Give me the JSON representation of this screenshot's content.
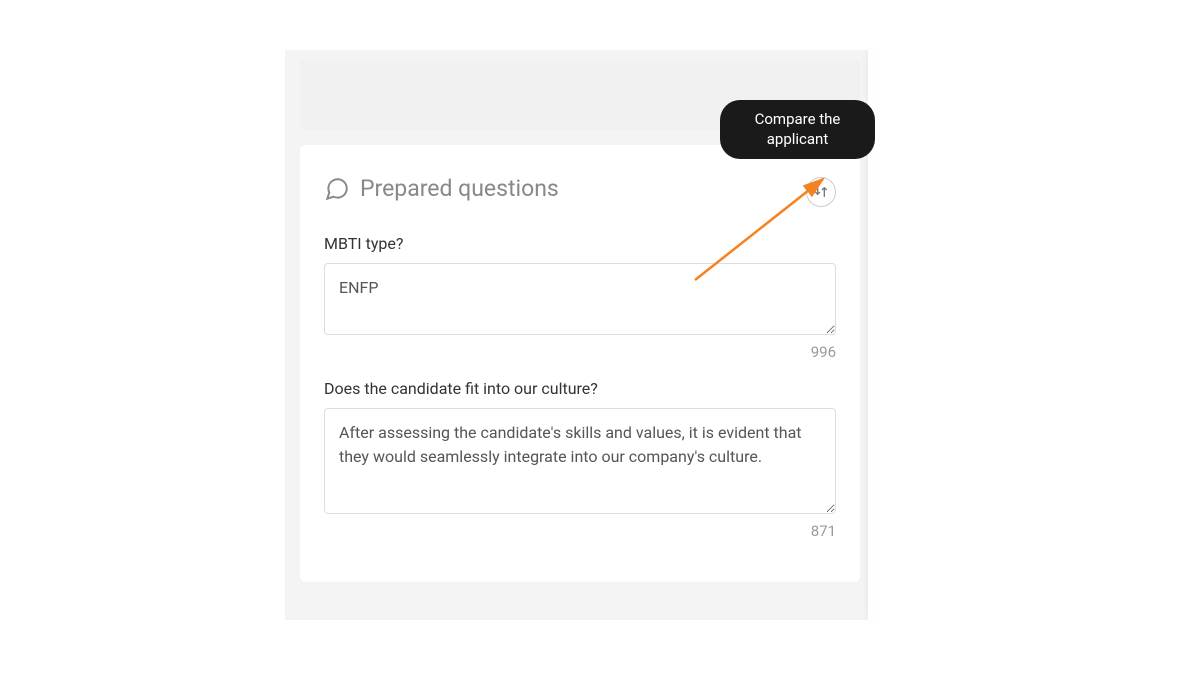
{
  "tooltip": {
    "text": "Compare the applicant"
  },
  "section": {
    "title": "Prepared questions",
    "questions": [
      {
        "label": "MBTI type?",
        "value": "ENFP",
        "counter": "996"
      },
      {
        "label": "Does the candidate fit into our culture?",
        "value": "After assessing the candidate's skills and values, it is evident that they would seamlessly integrate into our company's culture.",
        "counter": "871"
      }
    ]
  }
}
